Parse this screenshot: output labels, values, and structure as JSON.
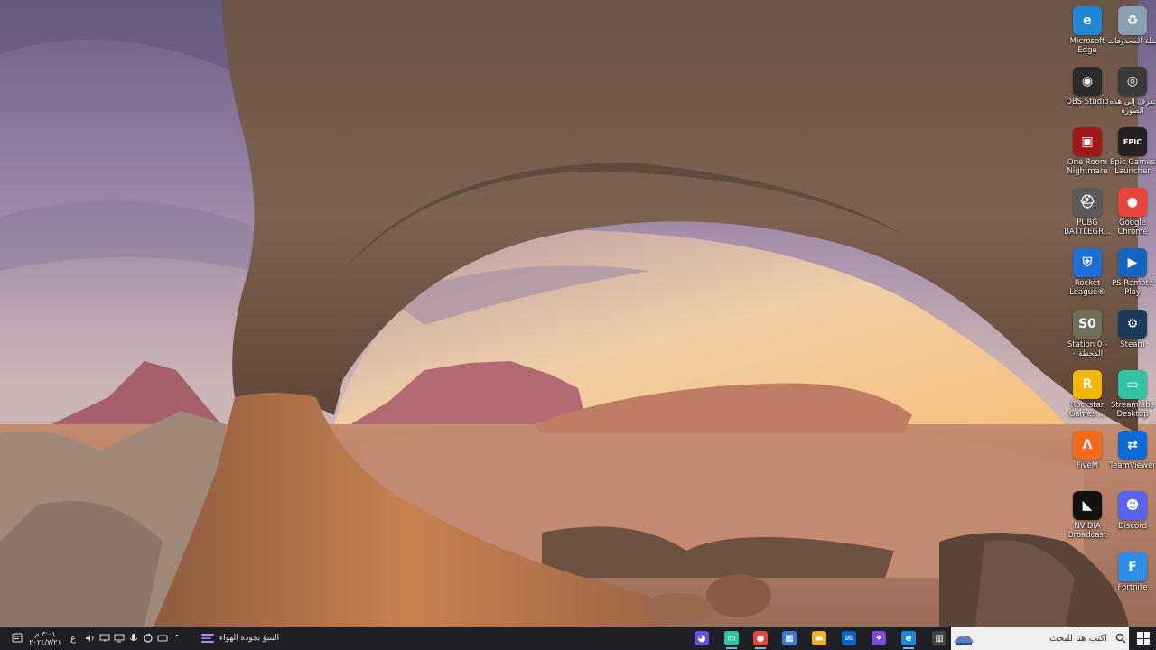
{
  "desktop": {
    "icons": [
      {
        "label": "Microsoft Edge",
        "icon": "edge-icon",
        "color": "#1e88d8",
        "glyph": "e"
      },
      {
        "label": "سلة المحذوفات",
        "icon": "recycle-bin-icon",
        "color": "#8aa0b0",
        "glyph": "♻"
      },
      {
        "label": "OBS Studio",
        "icon": "obs-icon",
        "color": "#2b2b2b",
        "glyph": "◉"
      },
      {
        "label": "تعرف إلى هذه الصورة",
        "icon": "camera-icon",
        "color": "#3a3a3a",
        "glyph": "◎"
      },
      {
        "label": "One Room Nightmare",
        "icon": "one-room-icon",
        "color": "#a01818",
        "glyph": "▣"
      },
      {
        "label": "Epic Games Launcher",
        "icon": "epic-games-icon",
        "color": "#222222",
        "glyph": "EPIC"
      },
      {
        "label": "PUBG BATTLEGR...",
        "icon": "pubg-icon",
        "color": "#5a5a5a",
        "glyph": "⛑"
      },
      {
        "label": "Google Chrome",
        "icon": "chrome-icon",
        "color": "#e8443a",
        "glyph": "●"
      },
      {
        "label": "Rocket League®",
        "icon": "rocket-league-icon",
        "color": "#1d6fd6",
        "glyph": "⛨"
      },
      {
        "label": "PS Remote Play",
        "icon": "ps-remote-play-icon",
        "color": "#1565c0",
        "glyph": "▶"
      },
      {
        "label": "Station 0 - المحطة ٠",
        "icon": "station-zero-icon",
        "color": "#6f6f5a",
        "glyph": "S0"
      },
      {
        "label": "Steam",
        "icon": "steam-icon",
        "color": "#1b3a5c",
        "glyph": "⚙"
      },
      {
        "label": "Rockstar Games ...",
        "icon": "rockstar-icon",
        "color": "#f2b705",
        "glyph": "R"
      },
      {
        "label": "Streamlabs Desktop",
        "icon": "streamlabs-icon",
        "color": "#31c3a2",
        "glyph": "▭"
      },
      {
        "label": "FiveM",
        "icon": "fivem-icon",
        "color": "#f26a1b",
        "glyph": "Λ"
      },
      {
        "label": "TeamViewer",
        "icon": "teamviewer-icon",
        "color": "#0e6ad6",
        "glyph": "⇄"
      },
      {
        "label": "NVIDIA Broadcast",
        "icon": "nvidia-broadcast-icon",
        "color": "#111111",
        "glyph": "◣"
      },
      {
        "label": "Discord",
        "icon": "discord-icon",
        "color": "#5865f2",
        "glyph": "☻"
      },
      {
        "label": "",
        "icon": "blank-icon",
        "color": "transparent",
        "glyph": ""
      },
      {
        "label": "Fortnite",
        "icon": "fortnite-icon",
        "color": "#2f8fe8",
        "glyph": "F"
      }
    ]
  },
  "taskbar": {
    "search_placeholder": "اكتب هنا للبحث",
    "weather_text": "التنبؤ بجودة الهواء",
    "clock_time": "٣:٠١ م",
    "clock_date": "٢٠٢٤/٧/٢١",
    "language": "ع",
    "pinned": [
      {
        "icon": "task-view-icon",
        "color": "#444444",
        "glyph": "▥"
      },
      {
        "icon": "edge-icon",
        "color": "#1e88d8",
        "glyph": "e"
      },
      {
        "icon": "copilot-icon",
        "color": "#7a4fd8",
        "glyph": "✦"
      },
      {
        "icon": "outlook-icon",
        "color": "#0a64c8",
        "glyph": "✉"
      },
      {
        "icon": "file-explorer-icon",
        "color": "#e8b32a",
        "glyph": "▬"
      },
      {
        "icon": "store-icon",
        "color": "#3a7bd5",
        "glyph": "▦"
      },
      {
        "icon": "chrome-icon",
        "color": "#e8443a",
        "glyph": "●"
      },
      {
        "icon": "streamlabs-icon",
        "color": "#31c3a2",
        "glyph": "▭"
      },
      {
        "icon": "app-icon",
        "color": "#6a4de0",
        "glyph": "◕"
      }
    ]
  },
  "colors": {
    "taskbar_bg": "#1f2025",
    "search_bg": "#f0f0f0",
    "accent": "#7fb3e8"
  }
}
